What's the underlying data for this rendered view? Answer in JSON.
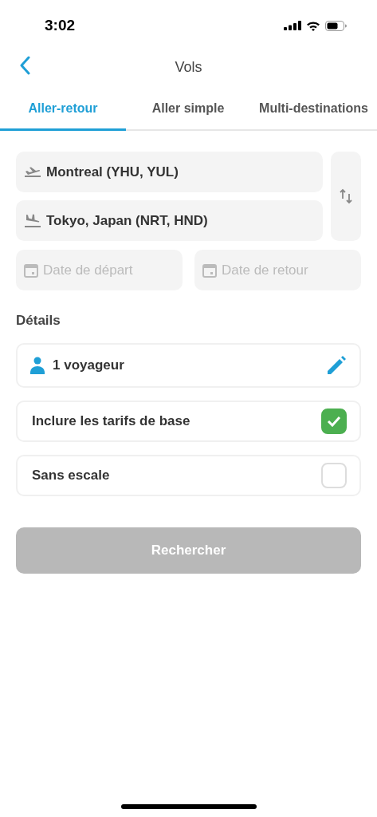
{
  "status_bar": {
    "time": "3:02"
  },
  "nav": {
    "title": "Vols"
  },
  "tabs": [
    {
      "label": "Aller-retour",
      "selected": true
    },
    {
      "label": "Aller simple",
      "selected": false
    },
    {
      "label": "Multi-destinations",
      "selected": false
    }
  ],
  "route": {
    "origin": "Montreal (YHU, YUL)",
    "destination": "Tokyo, Japan (NRT, HND)"
  },
  "dates": [
    {
      "placeholder": "Date de départ"
    },
    {
      "placeholder": "Date de retour"
    }
  ],
  "details": {
    "title": "Détails",
    "travellers": "1 voyageur",
    "options": [
      {
        "label": "Inclure les tarifs de base",
        "checked": true
      },
      {
        "label": "Sans escale",
        "checked": false
      }
    ]
  },
  "search_button": {
    "label": "Rechercher",
    "disabled": true
  }
}
